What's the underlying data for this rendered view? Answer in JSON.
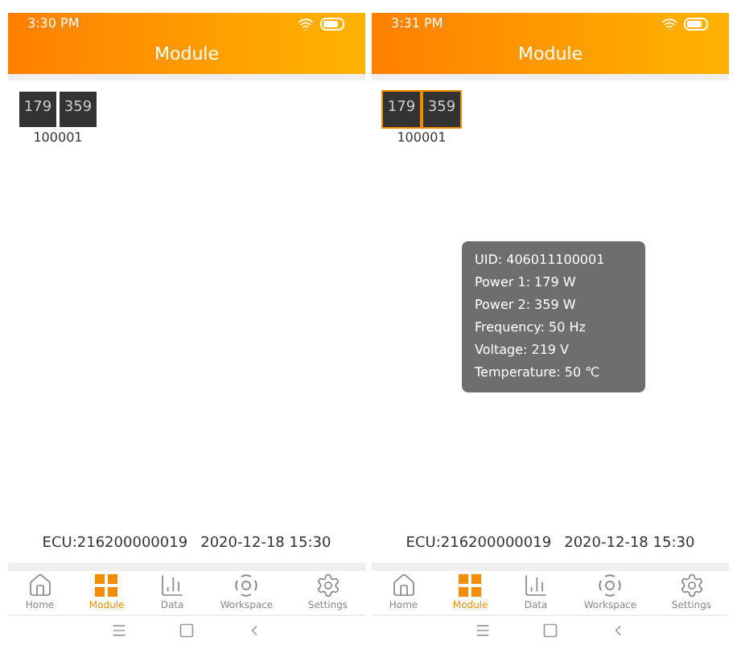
{
  "screens": [
    {
      "status_time": "3:30 PM",
      "title": "Module",
      "modules": [
        {
          "powers": [
            "179",
            "359"
          ],
          "id": "100001",
          "selected": false
        }
      ],
      "ecu": "ECU:216200000019",
      "ecu_time": "2020-12-18 15:30",
      "tabs": [
        {
          "kind": "home",
          "label": "Home",
          "selected": false
        },
        {
          "kind": "module",
          "label": "Module",
          "selected": true
        },
        {
          "kind": "data",
          "label": "Data",
          "selected": false
        },
        {
          "kind": "workspace",
          "label": "Workspace",
          "selected": false
        },
        {
          "kind": "settings",
          "label": "Settings",
          "selected": false
        }
      ]
    },
    {
      "status_time": "3:31 PM",
      "title": "Module",
      "modules": [
        {
          "powers": [
            "179",
            "359"
          ],
          "id": "100001",
          "selected": true
        }
      ],
      "tooltip": [
        "UID: 406011100001",
        "Power 1: 179 W",
        "Power 2: 359 W",
        "Frequency: 50 Hz",
        "Voltage: 219 V",
        "Temperature: 50 ℃"
      ],
      "ecu": "ECU:216200000019",
      "ecu_time": "2020-12-18 15:30",
      "tabs": [
        {
          "kind": "home",
          "label": "Home",
          "selected": false
        },
        {
          "kind": "module",
          "label": "Module",
          "selected": true
        },
        {
          "kind": "data",
          "label": "Data",
          "selected": false
        },
        {
          "kind": "workspace",
          "label": "Workspace",
          "selected": false
        },
        {
          "kind": "settings",
          "label": "Settings",
          "selected": false
        }
      ]
    }
  ]
}
